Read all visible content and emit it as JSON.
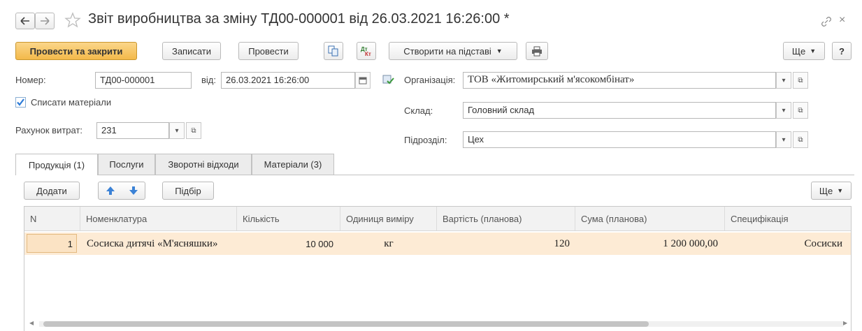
{
  "window": {
    "title": "Звіт виробництва за зміну ТД00-000001 від 26.03.2021 16:26:00 *"
  },
  "toolbar": {
    "post_close": "Провести та закрити",
    "save": "Записати",
    "post": "Провести",
    "create_based": "Створити на підставі",
    "more": "Ще",
    "help": "?"
  },
  "form": {
    "number_label": "Номер:",
    "number_value": "ТД00-000001",
    "date_label": "від:",
    "date_value": "26.03.2021 16:26:00",
    "write_off_label": "Списати матеріали",
    "write_off_checked": true,
    "cost_account_label": "Рахунок витрат:",
    "cost_account_value": "231",
    "org_label": "Організація:",
    "org_value": "ТОВ «Житомирський м'ясокомбінат»",
    "warehouse_label": "Склад:",
    "warehouse_value": "Головний склад",
    "division_label": "Підрозділ:",
    "division_value": "Цех"
  },
  "tabs": [
    {
      "label": "Продукція (1)",
      "active": true
    },
    {
      "label": "Послуги",
      "active": false
    },
    {
      "label": "Зворотні відходи",
      "active": false
    },
    {
      "label": "Матеріали (3)",
      "active": false
    }
  ],
  "table_toolbar": {
    "add": "Додати",
    "select": "Підбір",
    "more": "Ще"
  },
  "table": {
    "columns": [
      "N",
      "Номенклатура",
      "Кількість",
      "Одиниця виміру",
      "Вартість (планова)",
      "Сума (планова)",
      "Специфікація"
    ],
    "rows": [
      [
        "1",
        "Сосиска дитячі «М'ясняшки»",
        "10 000",
        "кг",
        "120",
        "1 200 000,00",
        "Сосиски"
      ]
    ]
  },
  "colors": {
    "accent": "#f3b94a",
    "selected_row": "#fdebd5"
  }
}
